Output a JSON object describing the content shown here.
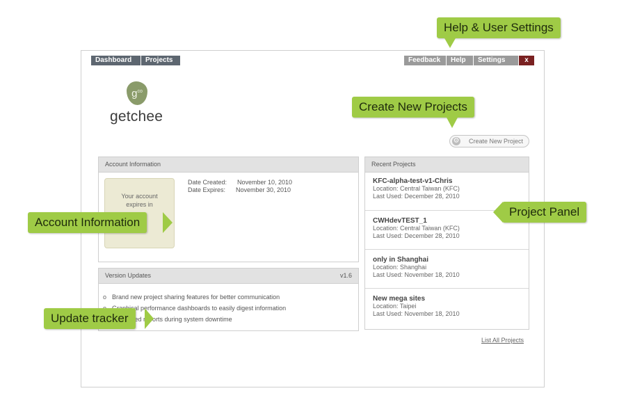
{
  "nav": {
    "left": [
      "Dashboard",
      "Projects"
    ],
    "feedback": "Feedback",
    "help": "Help",
    "settings": "Settings",
    "close": "x"
  },
  "logo": {
    "mark": "g",
    "mark_sup": "co",
    "text": "getchee"
  },
  "create_project": {
    "label": "Create New Project"
  },
  "account": {
    "title": "Account Information",
    "box_line1": "Your account",
    "box_line2": "expires in",
    "date_created_label": "Date Created:",
    "date_created": "November 10, 2010",
    "date_expires_label": "Date Expires:",
    "date_expires": "November 30, 2010"
  },
  "version": {
    "title": "Version Updates",
    "version": "v1.6",
    "items": [
      "Brand new project sharing features for better communication",
      "Graphical performance dashboards to easily digest information",
      "Scheduled reports during system downtime"
    ]
  },
  "recent": {
    "title": "Recent Projects",
    "projects": [
      {
        "name": "KFC-alpha-test-v1-Chris",
        "location": "Location: Central Taiwan (KFC)",
        "last_used": "Last Used: December 28, 2010"
      },
      {
        "name": "CWHdevTEST_1",
        "location": "Location: Central Taiwan (KFC)",
        "last_used": "Last Used: December 28, 2010"
      },
      {
        "name": "only in Shanghai",
        "location": "Location: Shanghai",
        "last_used": "Last Used: November 18, 2010"
      },
      {
        "name": "New mega sites",
        "location": "Location: Taipei",
        "last_used": "Last Used: November 18, 2010"
      }
    ],
    "list_all": "List All Projects"
  },
  "callouts": {
    "help_settings": "Help & User Settings",
    "create_new": "Create New Projects",
    "account_info": "Account Information",
    "project_panel": "Project Panel",
    "update_tracker": "Update tracker"
  },
  "colors": {
    "callout": "#9fcb46",
    "nav_dark": "#5d6670",
    "nav_gray": "#9a9a9a",
    "nav_close": "#7a2121",
    "logo": "#8a9b6a"
  }
}
